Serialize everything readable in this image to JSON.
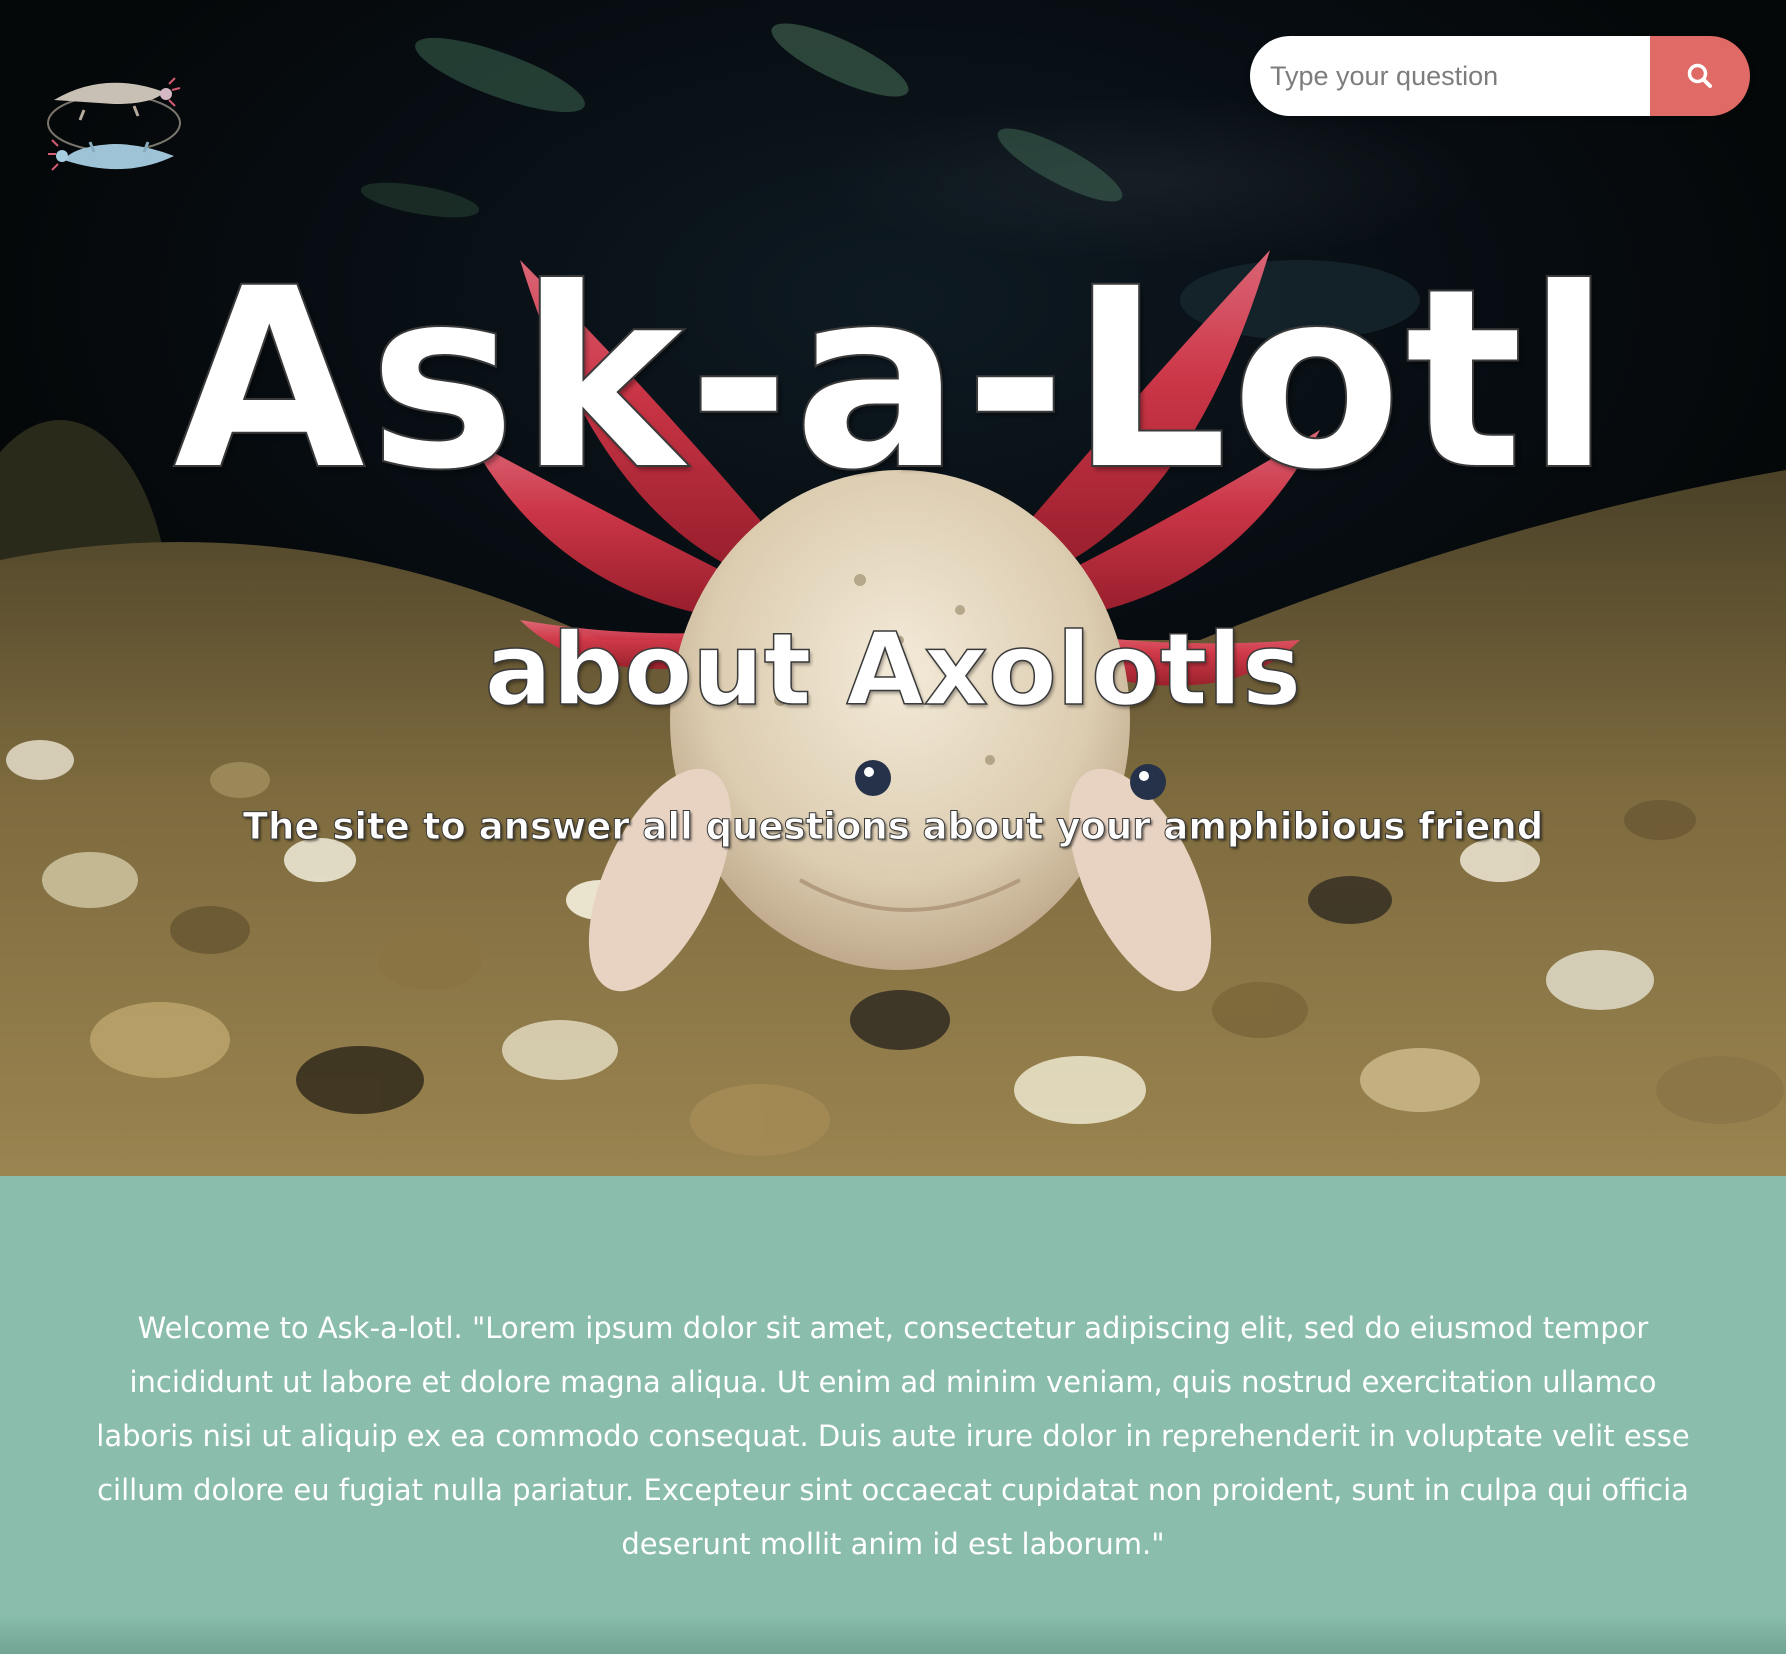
{
  "header": {
    "logo": {
      "icon": "axolotl-pair-logo-icon"
    },
    "search": {
      "placeholder": "Type your question",
      "value": "",
      "button_icon": "search-icon",
      "button_color": "#e06a66"
    }
  },
  "hero": {
    "title": "Ask-a-Lotl",
    "subtitle": "about Axolotls",
    "tagline": "The site to answer all questions about your amphibious friend",
    "background": "axolotl-aquarium-photo"
  },
  "welcome": {
    "text": "Welcome to Ask-a-lotl. \"Lorem ipsum dolor sit amet, consectetur adipiscing elit, sed do eiusmod tempor incididunt ut labore et dolore magna aliqua. Ut enim ad minim veniam, quis nostrud exercitation ullamco laboris nisi ut aliquip ex ea commodo consequat. Duis aute irure dolor in reprehenderit in voluptate velit esse cillum dolore eu fugiat nulla pariatur. Excepteur sint occaecat cupidatat non proident, sunt in culpa qui officia deserunt mollit anim id est laborum.\"",
    "background_color": "#8abdab"
  }
}
